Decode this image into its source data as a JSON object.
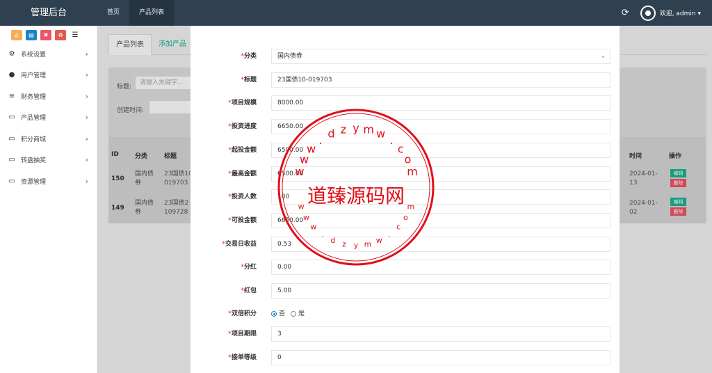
{
  "topbar": {
    "brand": "管理后台",
    "nav": [
      "首页",
      "产品列表"
    ],
    "refresh_icon": "refresh-icon",
    "welcome": "欢迎, admin ▾"
  },
  "sidebar": {
    "quick_buttons": [
      "home-icon",
      "file-icon",
      "trash-icon",
      "recycle-icon",
      "list-icon"
    ],
    "items": [
      {
        "label": "系统设置",
        "icon": "gears-icon"
      },
      {
        "label": "用户管理",
        "icon": "user-icon"
      },
      {
        "label": "财务管理",
        "icon": "database-icon"
      },
      {
        "label": "产品管理",
        "icon": "monitor-icon"
      },
      {
        "label": "积分商城",
        "icon": "monitor-icon"
      },
      {
        "label": "转盘抽奖",
        "icon": "monitor-icon"
      },
      {
        "label": "资源管理",
        "icon": "monitor-icon"
      }
    ]
  },
  "content": {
    "tabs": [
      "产品列表",
      "添加产品"
    ],
    "search": {
      "title_label": "标题:",
      "title_placeholder": "请输入关键字...",
      "created_label": "创建时间:"
    },
    "table": {
      "headers": {
        "id": "ID",
        "category": "分类",
        "title": "标题",
        "time": "时间",
        "ops": "操作"
      },
      "rows": [
        {
          "id": "150",
          "category": [
            "国内债",
            "券"
          ],
          "title": [
            "23国债10",
            "019703"
          ],
          "time": [
            "2024-01-",
            "13"
          ],
          "edit": "编辑",
          "delete": "删除"
        },
        {
          "id": "149",
          "category": [
            "国内债",
            "券"
          ],
          "title": [
            "23国债2",
            "109728"
          ],
          "time": [
            "2024-01-",
            "02"
          ],
          "edit": "编辑",
          "delete": "删除"
        }
      ]
    }
  },
  "form": {
    "fields": [
      {
        "label": "分类",
        "value": "国内债券",
        "type": "select"
      },
      {
        "label": "标题",
        "value": "23国债10-019703"
      },
      {
        "label": "项目规模",
        "value": "8000.00"
      },
      {
        "label": "投资进度",
        "value": "6650.00"
      },
      {
        "label": "起投金额",
        "value": "6500.00"
      },
      {
        "label": "最高金额",
        "value": "6500.00"
      },
      {
        "label": "投资人数",
        "value": "100"
      },
      {
        "label": "可投金额",
        "value": "6650.00"
      },
      {
        "label": "交易日收益",
        "value": "0.53"
      },
      {
        "label": "分红",
        "value": "0.00"
      },
      {
        "label": "红包",
        "value": "5.00"
      },
      {
        "label": "双倍积分",
        "type": "radio",
        "options": [
          "否",
          "是"
        ],
        "selected": "否"
      },
      {
        "label": "项目期限",
        "value": "3"
      },
      {
        "label": "接单等级",
        "value": "0"
      }
    ]
  },
  "watermark": {
    "center_text": "道臻源码网",
    "ring_text": "www.dzymw.com"
  }
}
